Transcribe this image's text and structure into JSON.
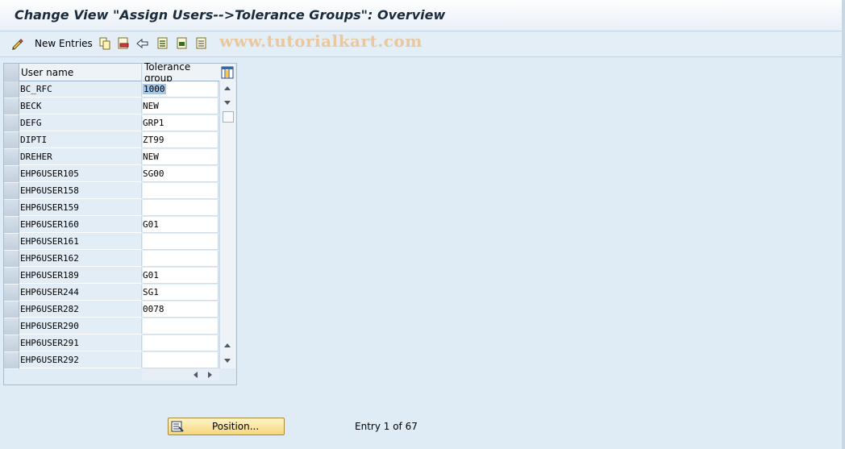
{
  "window": {
    "title": "Change View \"Assign Users-->Tolerance Groups\": Overview"
  },
  "toolbar": {
    "new_entries_label": "New Entries",
    "icons": [
      "display-change-icon",
      "copy-as-icon",
      "delete-icon",
      "undo-change-icon",
      "select-all-icon",
      "select-block-icon",
      "deselect-all-icon"
    ]
  },
  "watermark": "www.tutorialkart.com",
  "table": {
    "columns": {
      "user": "User name",
      "tolerance": "Tolerance group"
    },
    "rows": [
      {
        "user": "BC_RFC",
        "tolerance": "1000"
      },
      {
        "user": "BECK",
        "tolerance": "NEW"
      },
      {
        "user": "DEFG",
        "tolerance": "GRP1"
      },
      {
        "user": "DIPTI",
        "tolerance": "ZT99"
      },
      {
        "user": "DREHER",
        "tolerance": "NEW"
      },
      {
        "user": "EHP6USER105",
        "tolerance": "SG00"
      },
      {
        "user": "EHP6USER158",
        "tolerance": ""
      },
      {
        "user": "EHP6USER159",
        "tolerance": ""
      },
      {
        "user": "EHP6USER160",
        "tolerance": "G01"
      },
      {
        "user": "EHP6USER161",
        "tolerance": ""
      },
      {
        "user": "EHP6USER162",
        "tolerance": ""
      },
      {
        "user": "EHP6USER189",
        "tolerance": "G01"
      },
      {
        "user": "EHP6USER244",
        "tolerance": "SG1"
      },
      {
        "user": "EHP6USER282",
        "tolerance": "0078"
      },
      {
        "user": "EHP6USER290",
        "tolerance": ""
      },
      {
        "user": "EHP6USER291",
        "tolerance": ""
      },
      {
        "user": "EHP6USER292",
        "tolerance": ""
      }
    ]
  },
  "footer": {
    "position_button": "Position...",
    "entry_info": "Entry 1 of 67"
  },
  "colors": {
    "background": "#dfebf5",
    "button_accent": "#f5d77b"
  }
}
